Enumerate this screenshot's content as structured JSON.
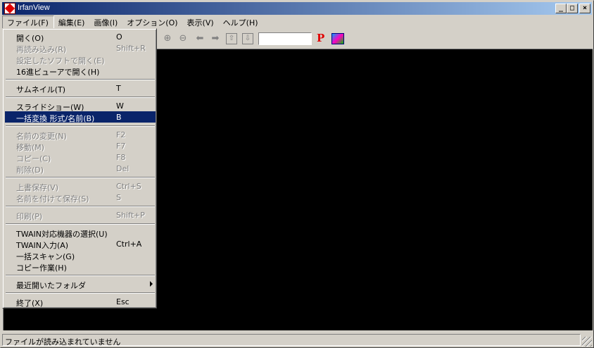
{
  "window": {
    "title": "IrfanView",
    "controls": {
      "minimize": "_",
      "maximize": "□",
      "close": "×"
    }
  },
  "menubar": [
    {
      "label": "ファイル(F)",
      "open": true
    },
    {
      "label": "編集(E)"
    },
    {
      "label": "画像(I)"
    },
    {
      "label": "オプション(O)"
    },
    {
      "label": "表示(V)"
    },
    {
      "label": "ヘルプ(H)"
    }
  ],
  "toolbar": {
    "icons": [
      "zoom-in-icon",
      "zoom-out-icon",
      "arrow-left-icon",
      "arrow-right-icon",
      "upload-icon",
      "download-icon"
    ],
    "glyphs": [
      "⊕",
      "⊖",
      "⬅",
      "➡",
      "⇧",
      "⇩"
    ],
    "search_value": "",
    "p_label": "P"
  },
  "file_menu": {
    "items": [
      {
        "label": "開く(O)",
        "shortcut": "O",
        "disabled": false
      },
      {
        "label": "再読み込み(R)",
        "shortcut": "Shift+R",
        "disabled": true
      },
      {
        "label": "設定したソフトで開く(E)",
        "shortcut": "",
        "disabled": true
      },
      {
        "label": "16進ビューアで開く(H)",
        "shortcut": "",
        "disabled": false
      },
      {
        "separator": true
      },
      {
        "label": "サムネイル(T)",
        "shortcut": "T",
        "disabled": false
      },
      {
        "separator": true
      },
      {
        "label": "スライドショー(W)",
        "shortcut": "W",
        "disabled": false
      },
      {
        "label": "一括変換 形式/名前(B)",
        "shortcut": "B",
        "disabled": false,
        "selected": true
      },
      {
        "separator": true
      },
      {
        "label": "名前の変更(N)",
        "shortcut": "F2",
        "disabled": true
      },
      {
        "label": "移動(M)",
        "shortcut": "F7",
        "disabled": true
      },
      {
        "label": "コピー(C)",
        "shortcut": "F8",
        "disabled": true
      },
      {
        "label": "削除(D)",
        "shortcut": "Del",
        "disabled": true
      },
      {
        "separator": true
      },
      {
        "label": "上書保存(V)",
        "shortcut": "Ctrl+S",
        "disabled": true
      },
      {
        "label": "名前を付けて保存(S)",
        "shortcut": "S",
        "disabled": true
      },
      {
        "separator": true
      },
      {
        "label": "印刷(P)",
        "shortcut": "Shift+P",
        "disabled": true
      },
      {
        "separator": true
      },
      {
        "label": "TWAIN対応機器の選択(U)",
        "shortcut": "",
        "disabled": false
      },
      {
        "label": "TWAIN入力(A)",
        "shortcut": "Ctrl+A",
        "disabled": false
      },
      {
        "label": "一括スキャン(G)",
        "shortcut": "",
        "disabled": false
      },
      {
        "label": "コピー作業(H)",
        "shortcut": "",
        "disabled": false
      },
      {
        "separator": true
      },
      {
        "label": "最近開いたフォルダ",
        "shortcut": "",
        "disabled": false,
        "submenu": true
      },
      {
        "separator": true
      },
      {
        "label": "終了(X)",
        "shortcut": "Esc",
        "disabled": false
      }
    ]
  },
  "statusbar": {
    "text": "ファイルが読み込まれていません"
  }
}
